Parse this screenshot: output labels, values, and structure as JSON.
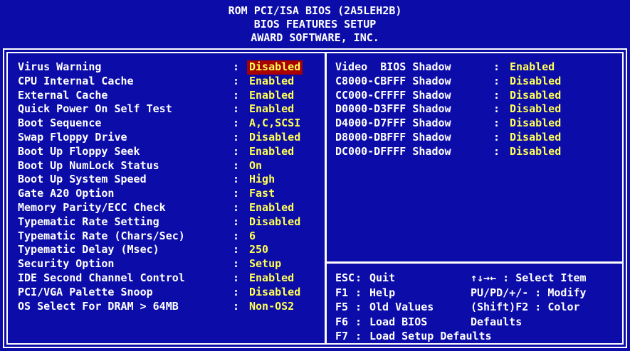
{
  "header": {
    "line1": "ROM PCI/ISA BIOS (2A5LEH2B)",
    "line2": "BIOS FEATURES SETUP",
    "line3": "AWARD SOFTWARE, INC."
  },
  "colors": {
    "background": "#0c0ca8",
    "text": "#ffffff",
    "value": "#ffff54",
    "highlight": "#a80000"
  },
  "settings": [
    {
      "label": "Virus Warning",
      "value": "Disabled",
      "selected": true
    },
    {
      "label": "CPU Internal Cache",
      "value": "Enabled"
    },
    {
      "label": "External Cache",
      "value": "Enabled"
    },
    {
      "label": "Quick Power On Self Test",
      "value": "Enabled"
    },
    {
      "label": "Boot Sequence",
      "value": "A,C,SCSI"
    },
    {
      "label": "Swap Floppy Drive",
      "value": "Disabled"
    },
    {
      "label": "Boot Up Floppy Seek",
      "value": "Enabled"
    },
    {
      "label": "Boot Up NumLock Status",
      "value": "On"
    },
    {
      "label": "Boot Up System Speed",
      "value": "High"
    },
    {
      "label": "Gate A20 Option",
      "value": "Fast"
    },
    {
      "label": "Memory Parity/ECC Check",
      "value": "Enabled"
    },
    {
      "label": "Typematic Rate Setting",
      "value": "Disabled"
    },
    {
      "label": "Typematic Rate (Chars/Sec)",
      "value": "6"
    },
    {
      "label": "Typematic Delay (Msec)",
      "value": "250"
    },
    {
      "label": "Security Option",
      "value": "Setup"
    },
    {
      "label": "IDE Second Channel Control",
      "value": "Enabled"
    },
    {
      "label": "PCI/VGA Palette Snoop",
      "value": "Disabled"
    },
    {
      "label": "OS Select For DRAM > 64MB",
      "value": "Non-OS2"
    }
  ],
  "shadow": [
    {
      "label": "Video  BIOS Shadow",
      "value": "Enabled"
    },
    {
      "label": "C8000-CBFFF Shadow",
      "value": "Disabled"
    },
    {
      "label": "CC000-CFFFF Shadow",
      "value": "Disabled"
    },
    {
      "label": "D0000-D3FFF Shadow",
      "value": "Disabled"
    },
    {
      "label": "D4000-D7FFF Shadow",
      "value": "Disabled"
    },
    {
      "label": "D8000-DBFFF Shadow",
      "value": "Disabled"
    },
    {
      "label": "DC000-DFFFF Shadow",
      "value": "Disabled"
    }
  ],
  "help": [
    {
      "key": "ESC",
      "desc": "Quit",
      "right": "↑↓→← : Select Item"
    },
    {
      "key": "F1",
      "desc": "Help",
      "right": "PU/PD/+/- : Modify"
    },
    {
      "key": "F5",
      "desc": "Old Values",
      "right": "(Shift)F2 : Color"
    },
    {
      "key": "F6",
      "desc": "Load BIOS",
      "right": "Defaults"
    },
    {
      "key": "F7",
      "desc": "Load Setup Defaults",
      "right": ""
    }
  ],
  "colon": ":"
}
